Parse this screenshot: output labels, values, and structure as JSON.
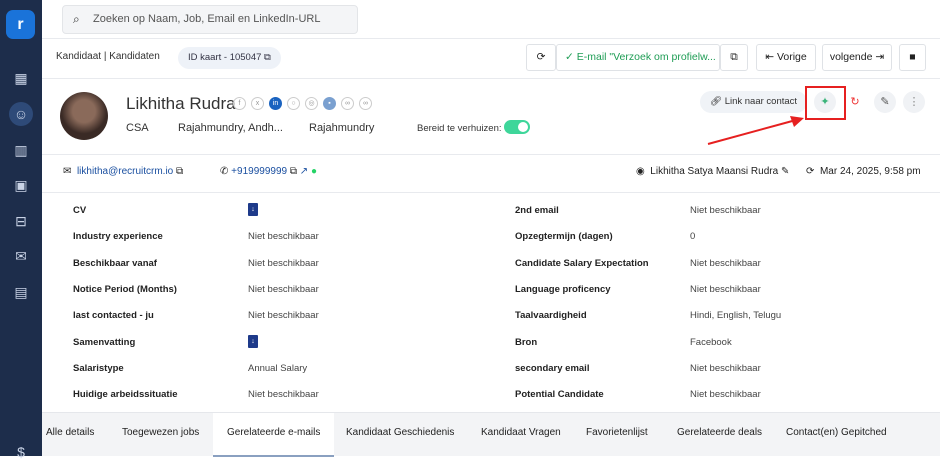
{
  "sidebar": {
    "items": [
      "dashboard-icon",
      "candidates-icon",
      "companies-icon",
      "contacts-icon",
      "jobs-icon",
      "email-icon",
      "calendar-icon"
    ],
    "active": "candidates-icon"
  },
  "search": {
    "placeholder": "Zoeken op Naam, Job, Email en LinkedIn-URL"
  },
  "breadcrumb": "Kandidaat | Kandidaten",
  "id_card": "ID kaart - 105047",
  "toolbar": {
    "email_status": "E-mail \"Verzoek om profielw...",
    "prev": "Vorige",
    "next": "volgende"
  },
  "profile": {
    "name": "Likhitha Rudra",
    "title": "CSA",
    "location": "Rajahmundry, Andh...",
    "city": "Rajahmundry",
    "relocate_label": "Bereid te verhuizen:",
    "relocate": true,
    "link_contact": "Link naar contact"
  },
  "contact": {
    "email": "likhitha@recruitcrm.io",
    "phone": "+919999999",
    "owner": "Likhitha Satya Maansi Rudra",
    "updated": "Mar 24, 2025, 9:58 pm"
  },
  "fields_left": [
    {
      "label": "CV",
      "value": "",
      "doc": true
    },
    {
      "label": "Industry experience",
      "value": "Niet beschikbaar"
    },
    {
      "label": "Beschikbaar vanaf",
      "value": "Niet beschikbaar"
    },
    {
      "label": "Notice Period (Months)",
      "value": "Niet beschikbaar"
    },
    {
      "label": "last contacted - ju",
      "value": "Niet beschikbaar"
    },
    {
      "label": "Samenvatting",
      "value": "",
      "doc": true
    },
    {
      "label": "Salaristype",
      "value": "Annual Salary"
    },
    {
      "label": "Huidige arbeidssituatie",
      "value": "Niet beschikbaar"
    }
  ],
  "fields_right": [
    {
      "label": "2nd email",
      "value": "Niet beschikbaar"
    },
    {
      "label": "Opzegtermijn (dagen)",
      "value": "0"
    },
    {
      "label": "Candidate Salary Expectation",
      "value": "Niet beschikbaar"
    },
    {
      "label": "Language proficency",
      "value": "Niet beschikbaar"
    },
    {
      "label": "Taalvaardigheid",
      "value": "Hindi, English, Telugu"
    },
    {
      "label": "Bron",
      "value": "Facebook"
    },
    {
      "label": "secondary email",
      "value": "Niet beschikbaar"
    },
    {
      "label": "Potential Candidate",
      "value": "Niet beschikbaar"
    }
  ],
  "tabs": [
    "Alle details",
    "Toegewezen jobs",
    "Gerelateerde e-mails",
    "Kandidaat Geschiedenis",
    "Kandidaat Vragen",
    "Favorietenlijst",
    "Gerelateerde deals",
    "Contact(en) Gepitched"
  ],
  "active_tab": "Gerelateerde e-mails",
  "colors": {
    "sidebar": "#1d2d4b",
    "accent": "#1a73d9",
    "success": "#1f9d55",
    "highlight": "#e62020"
  }
}
